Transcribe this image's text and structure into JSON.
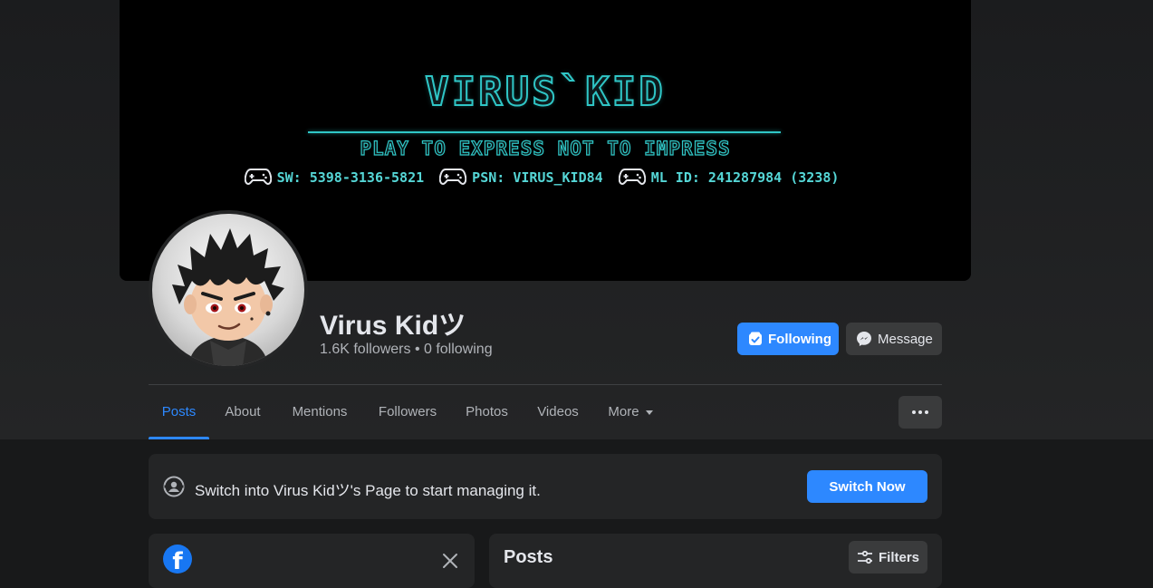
{
  "cover": {
    "title": "VIRUS`KID",
    "tagline": "PLAY TO EXPRESS NOT TO IMPRESS",
    "ids": [
      "SW: 5398-3136-5821",
      "PSN: VIRUS_KID84",
      "ML ID: 241287984 (3238)"
    ]
  },
  "profile": {
    "name": "Virus Kidツ",
    "stats": "1.6K followers • 0 following"
  },
  "actions": {
    "following_label": "Following",
    "message_label": "Message"
  },
  "tabs": [
    {
      "label": "Posts",
      "active": true
    },
    {
      "label": "About"
    },
    {
      "label": "Mentions"
    },
    {
      "label": "Followers"
    },
    {
      "label": "Photos"
    },
    {
      "label": "Videos"
    },
    {
      "label": "More"
    }
  ],
  "switch_banner": {
    "text": "Switch into Virus Kidツ's Page to start managing it.",
    "button_label": "Switch Now"
  },
  "posts_section": {
    "title": "Posts",
    "filters_label": "Filters"
  },
  "colors": {
    "accent": "#2d88ff",
    "background": "#18191a",
    "card": "#242526",
    "cover_neon": "#2fc6c6"
  }
}
